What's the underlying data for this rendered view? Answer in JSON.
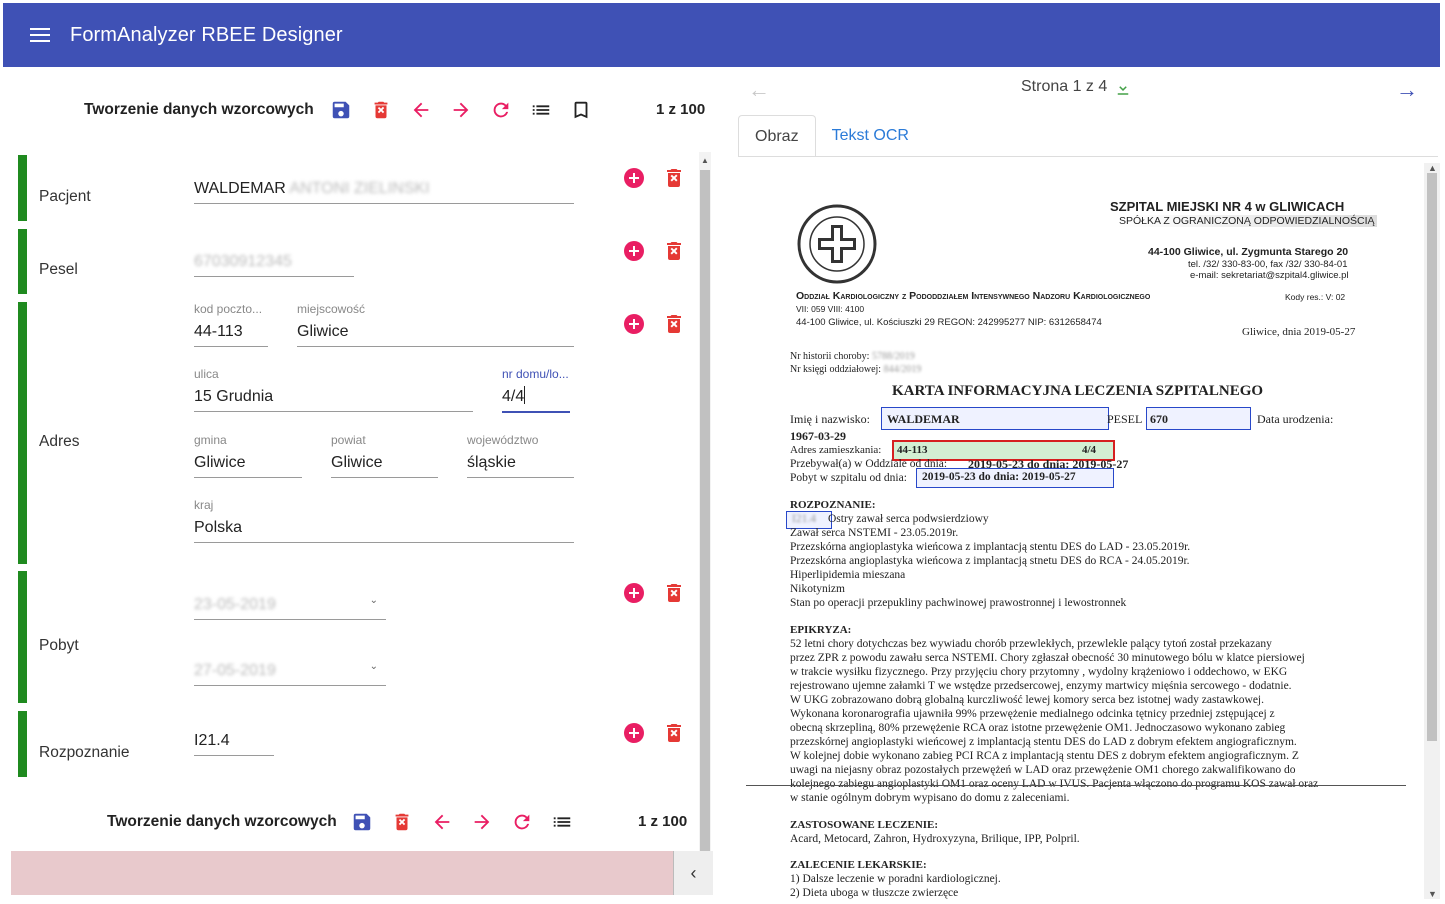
{
  "app": {
    "title": "FormAnalyzer RBEE Designer"
  },
  "toolbar": {
    "title": "Tworzenie danych wzorcowych",
    "counter": "1 z 100"
  },
  "form": {
    "pacjent": {
      "label": "Pacjent",
      "value": "WALDEMAR",
      "value_hidden": "ANTONI ZIELINSKI"
    },
    "pesel": {
      "label": "Pesel",
      "value_hidden": "67030912345"
    },
    "adres": {
      "label": "Adres",
      "kod_label": "kod poczto...",
      "kod": "44-113",
      "miejscowosc_label": "miejscowość",
      "miejscowosc": "Gliwice",
      "ulica_label": "ulica",
      "ulica": "15 Grudnia",
      "nr_label": "nr domu/lo...",
      "nr": "4/4",
      "gmina_label": "gmina",
      "gmina": "Gliwice",
      "powiat_label": "powiat",
      "powiat": "Gliwice",
      "woj_label": "województwo",
      "woj": "śląskie",
      "kraj_label": "kraj",
      "kraj": "Polska"
    },
    "pobyt": {
      "label": "Pobyt",
      "od": "23-05-2019",
      "do": "27-05-2019"
    },
    "rozpoznanie": {
      "label": "Rozpoznanie",
      "value": "I21.4"
    }
  },
  "viewer": {
    "page_info": "Strona 1 z 4",
    "tabs": [
      "Obraz",
      "Tekst OCR"
    ]
  },
  "doc": {
    "hospital": "SZPITAL MIEJSKI NR 4 w GLIWICACH",
    "company": "SPÓŁKA Z OGRANICZONĄ ODPOWIEDZIALNOŚCIĄ",
    "address": "44-100 Gliwice, ul. Zygmunta Starego 20",
    "tel": "tel. /32/ 330-83-00, fax /32/ 330-84-01",
    "email": "e-mail: sekretariat@szpital4.gliwice.pl",
    "dept": "Oddział Kardiologiczny z Pododdziałem Intensywnego Nadzoru Kardiologicznego",
    "code": "Kody res.: V: 02",
    "vii": "VII: 059 VIII: 4100",
    "regon": "44-100 Gliwice, ul. Kościuszki 29  REGON: 242995277  NIP: 6312658474",
    "date": "Gliwice, dnia 2019-05-27",
    "nr_hist": "Nr historii choroby:",
    "nr_hist_val": "5788/2019",
    "nr_ksiegi": "Nr księgi oddziałowej:",
    "nr_ksiegi_val": "844/2019",
    "heading": "KARTA INFORMACYJNA LECZENIA SZPITALNEGO",
    "imie_label": "Imię i nazwisko:",
    "imie_val": "WALDEMAR",
    "pesel_label": "PESEL",
    "pesel_val": "670",
    "dob_label": "Data urodzenia:",
    "dob": "1967-03-29",
    "adres_label": "Adres zamieszkania:",
    "adres_val": "44-113",
    "adres_tail": "4/4",
    "przebywal": "Przebywał(a) w Oddziale od dnia:",
    "przebywal_val": "2019-05-23 do dnia: 2019-05-27",
    "pobyt_label": "Pobyt w szpitalu od dnia:",
    "pobyt_val": "2019-05-23 do dnia: 2019-05-27",
    "rozpoznanie_h": "ROZPOZNANIE:",
    "rozp_code": "I21.4",
    "rozp_lines": [
      "Ostry zawał serca podwsierdziowy",
      "Zawał serca NSTEMI - 23.05.2019r.",
      "Przezskórna angioplastyka wieńcowa z implantacją stentu DES do LAD - 23.05.2019r.",
      "Przezskórna angioplastyka wieńcowa z implantacją stnetu DES do RCA - 24.05.2019r.",
      "Hiperlipidemia mieszana",
      "Nikotynizm",
      "Stan po operacji przepukliny pachwinowej prawostronnej i lewostronnek"
    ],
    "epikryza_h": "EPIKRYZA:",
    "epikryza_lines": [
      "52 letni chory dotychczas bez wywiadu chorób przewlekłych, przewlekle palący tytoń został przekazany",
      "przez ZPR z powodu zawału serca NSTEMI. Chory zgłaszał obecność 30 minutowego bólu w klatce piersiowej",
      "w trakcie wysiłku fizycznego. Przy przyjęciu chory przytomny , wydolny krążeniowo i oddechowo, w EKG",
      "rejestrowano ujemne załamki T we wstędze przedsercowej, enzymy martwicy mięśnia sercowego - dodatnie.",
      "W UKG zobrazowano dobrą globalną kurczliwość lewej komory serca bez istotnej wady zastawkowej.",
      "Wykonana koronarografia ujawniła 99% przewężenie medialnego odcinka tętnicy przedniej zstępującej z",
      "obecną skrzepliną, 80% przewężenie RCA oraz istotne przewężenie OM1. Jednoczasowo wykonano zabieg",
      "przezskórnej angioplastyki wieńcowej z implantacją stentu DES do LAD z dobrym efektem angiograficznym.",
      "W kolejnej dobie wykonano zabieg PCI RCA z implantacją stentu DES z dobrym efektem angiograficznym. Z",
      "uwagi na niejasny obraz pozostałych przewężeń w LAD oraz przewężenie OM1 chorego zakwalifikowano do",
      "kolejnego zabiegu angioplastyki OM1 oraz oceny LAD w IVUS. Pacjenta włączono do programu KOS zawał oraz",
      "w stanie ogólnym dobrym wypisano do domu z zaleceniami."
    ],
    "leczenie_h": "ZASTOSOWANE LECZENIE:",
    "leczenie": "Acard, Metocard, Zahron, Hydroxyzyna, Brilique, IPP, Polpril.",
    "zalecenie_h": "ZALECENIE LEKARSKIE:",
    "zalecenie_lines": [
      "1) Dalsze leczenie w poradni kardiologicznej.",
      "2) Dieta uboga w tłuszcze zwierzęce"
    ]
  }
}
